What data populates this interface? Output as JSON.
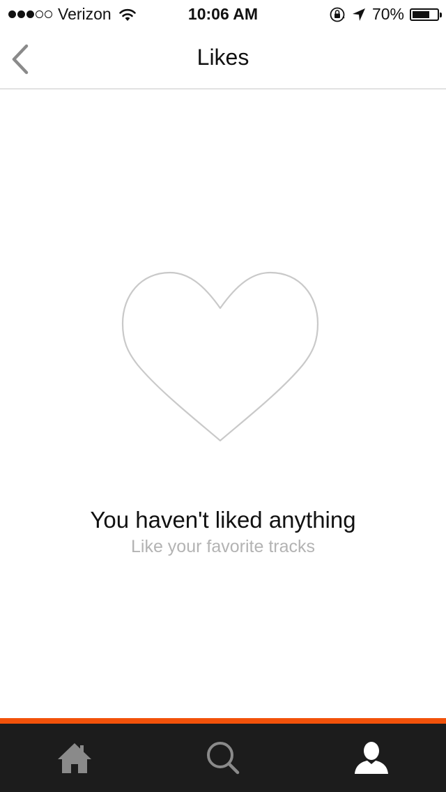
{
  "status_bar": {
    "signal_bars_filled": 3,
    "signal_bars_total": 5,
    "carrier": "Verizon",
    "time": "10:06 AM",
    "battery_percent_label": "70%",
    "battery_level": 0.7,
    "icons": [
      "wifi-icon",
      "orientation-lock-icon",
      "location-arrow-icon",
      "battery-icon"
    ]
  },
  "nav": {
    "back_icon": "chevron-left-icon",
    "title": "Likes"
  },
  "empty_state": {
    "icon": "heart-outline-icon",
    "title": "You haven't liked anything",
    "subtitle": "Like your favorite tracks"
  },
  "tab_bar": {
    "accent_color": "#f2520a",
    "background_color": "#1c1c1c",
    "tabs": [
      {
        "name": "home",
        "icon": "home-icon",
        "active": false
      },
      {
        "name": "search",
        "icon": "search-icon",
        "active": false
      },
      {
        "name": "profile",
        "icon": "profile-icon",
        "active": true
      }
    ]
  }
}
